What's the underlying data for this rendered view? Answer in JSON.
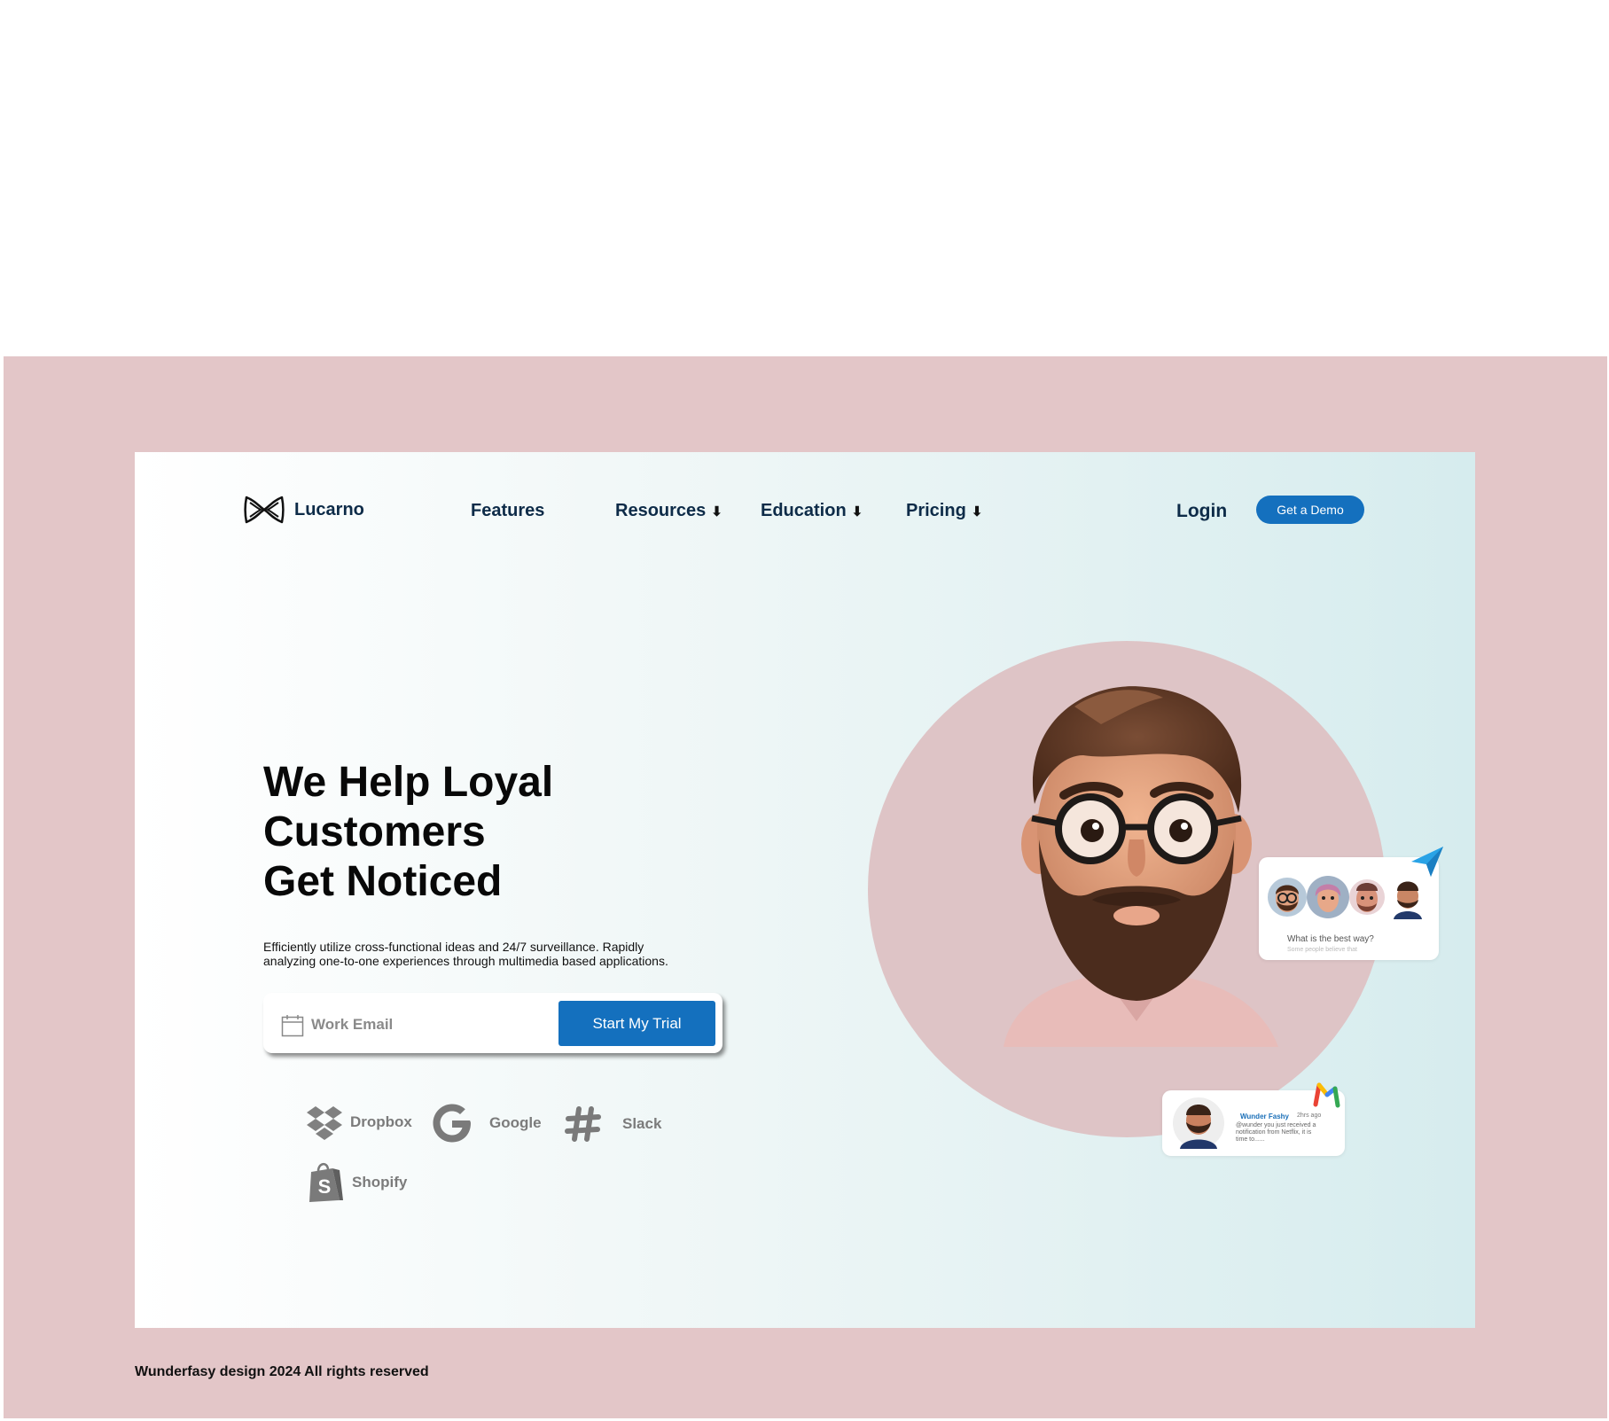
{
  "brand": {
    "name": "Lucarno"
  },
  "nav": {
    "items": [
      {
        "label": "Features",
        "arrow": ""
      },
      {
        "label": "Resources",
        "arrow": "⬇"
      },
      {
        "label": "Education",
        "arrow": "⬇"
      },
      {
        "label": "Pricing",
        "arrow": "⬇"
      }
    ],
    "login": "Login",
    "demo": "Get a Demo"
  },
  "hero": {
    "title_lines": [
      "We Help Loyal",
      "Customers",
      "Get Noticed"
    ],
    "description": "Efficiently utilize cross-functional ideas and 24/7 surveillance. Rapidly analyzing one-to-one experiences through multimedia based applications.",
    "email_placeholder": "Work Email",
    "cta": "Start My Trial"
  },
  "partners": [
    {
      "name": "Dropbox",
      "icon": "dropbox-icon"
    },
    {
      "name": "Google",
      "icon": "google-icon"
    },
    {
      "name": "Slack",
      "icon": "slack-icon"
    },
    {
      "name": "Shopify",
      "icon": "shopify-icon"
    }
  ],
  "chat_card": {
    "question": "What is the best way?",
    "subtext": "Some people believe that"
  },
  "notification": {
    "name": "Wunder Fashy",
    "time": "2hrs ago",
    "message": "@wunder you just received a notification from Netflix, it is time to......"
  },
  "footer": {
    "text": "Wunderfasy design 2024 All rights reserved"
  },
  "colors": {
    "accent": "#1470be",
    "frame": "#e3c6c8",
    "nav_text": "#0d2b48"
  }
}
